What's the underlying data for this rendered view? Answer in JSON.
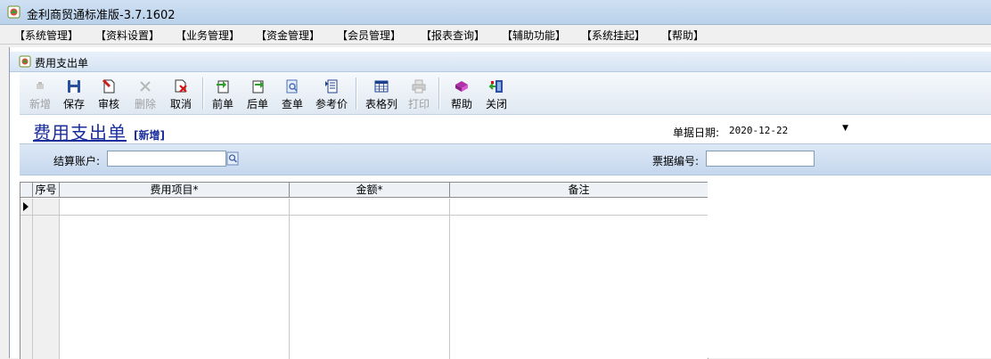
{
  "window": {
    "title": "金利商贸通标准版-3.7.1602"
  },
  "menu": [
    "【系统管理】",
    "【资料设置】",
    "【业务管理】",
    "【资金管理】",
    "【会员管理】",
    "【报表查询】",
    "【辅助功能】",
    "【系统挂起】",
    "【帮助】"
  ],
  "child_window": {
    "title": "费用支出单"
  },
  "toolbar": {
    "new": "新增",
    "save": "保存",
    "audit": "审核",
    "delete": "删除",
    "cancel": "取消",
    "prev": "前单",
    "next": "后单",
    "query": "查单",
    "ref_price": "参考价",
    "table_cols": "表格列",
    "print": "打印",
    "help": "帮助",
    "close": "关闭"
  },
  "form": {
    "title": "费用支出单",
    "status": "[新增]",
    "date_label": "单据日期:",
    "date_value": "2020-12-22",
    "account_label": "结算账户:",
    "account_value": "",
    "bill_no_label": "票据编号:",
    "bill_no_value": ""
  },
  "grid": {
    "columns": [
      "序号",
      "费用项目*",
      "金额*",
      "备注"
    ]
  },
  "colors": {
    "title_blue": "#1a2e9c",
    "toolbar_bg": "#dfe8f2",
    "filter_bg": "#c5d7ee"
  }
}
